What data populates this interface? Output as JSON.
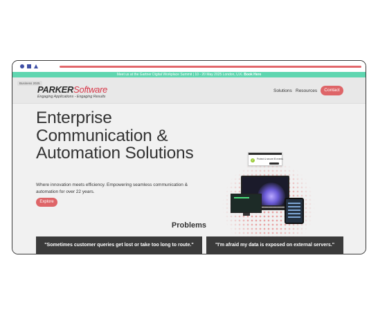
{
  "window": {
    "controls": [
      "circle",
      "square",
      "triangle"
    ],
    "accent_color": "#e2676b",
    "control_color": "#3f4fa5"
  },
  "banner": {
    "text": "Meet us at the Gartner Digital Workplace Summit | 10 - 20 May 2025 London, U.K. ",
    "link": "Book Here",
    "color": "#5fd6b0"
  },
  "nav": {
    "badge": "Business 2025",
    "logo_parker": "PARKER",
    "logo_software": "Software",
    "tagline": "Engaging Applications - Engaging Results",
    "links": [
      "Solutions",
      "Resources"
    ],
    "cta": "Contact",
    "cta_color": "#de6568"
  },
  "hero": {
    "title": "Enterprise Communication & Automation Solutions",
    "subtitle": "Where innovation meets efficiency. Empowering seamless communication & automation for over 22 years.",
    "cta": "Explore"
  },
  "illustration": {
    "card_top": "Protect & secure IB events",
    "card_left": "Get hidden data, save time",
    "card_right": "Lower growth for the office"
  },
  "problems": {
    "title": "Problems",
    "cards": [
      "\"Sometimes customer queries get lost or take too long to route.\"",
      "\"I'm afraid my data is exposed on external servers.\""
    ]
  }
}
